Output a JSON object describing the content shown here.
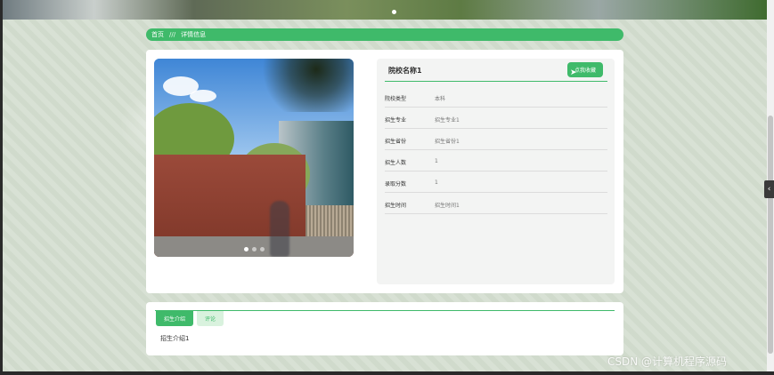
{
  "breadcrumb": {
    "home": "首页",
    "separator": "///",
    "current": "详情信息"
  },
  "school": {
    "name": "院校名称1",
    "favorite_label": "点我收藏",
    "fields": [
      {
        "label": "院校类型",
        "value": "本科"
      },
      {
        "label": "招生专业",
        "value": "招生专业1"
      },
      {
        "label": "招生省份",
        "value": "招生省份1"
      },
      {
        "label": "招生人数",
        "value": "1"
      },
      {
        "label": "录取分数",
        "value": "1"
      },
      {
        "label": "招生时间",
        "value": "招生时间1"
      }
    ]
  },
  "carousel": {
    "slide_count": 3,
    "active_index": 0
  },
  "tabs": [
    {
      "label": "招生介绍",
      "active": true
    },
    {
      "label": "评论",
      "active": false
    }
  ],
  "intro_text": "招生介绍1",
  "watermark": "CSDN @计算机程序源码",
  "accent_color": "#3fba6a"
}
